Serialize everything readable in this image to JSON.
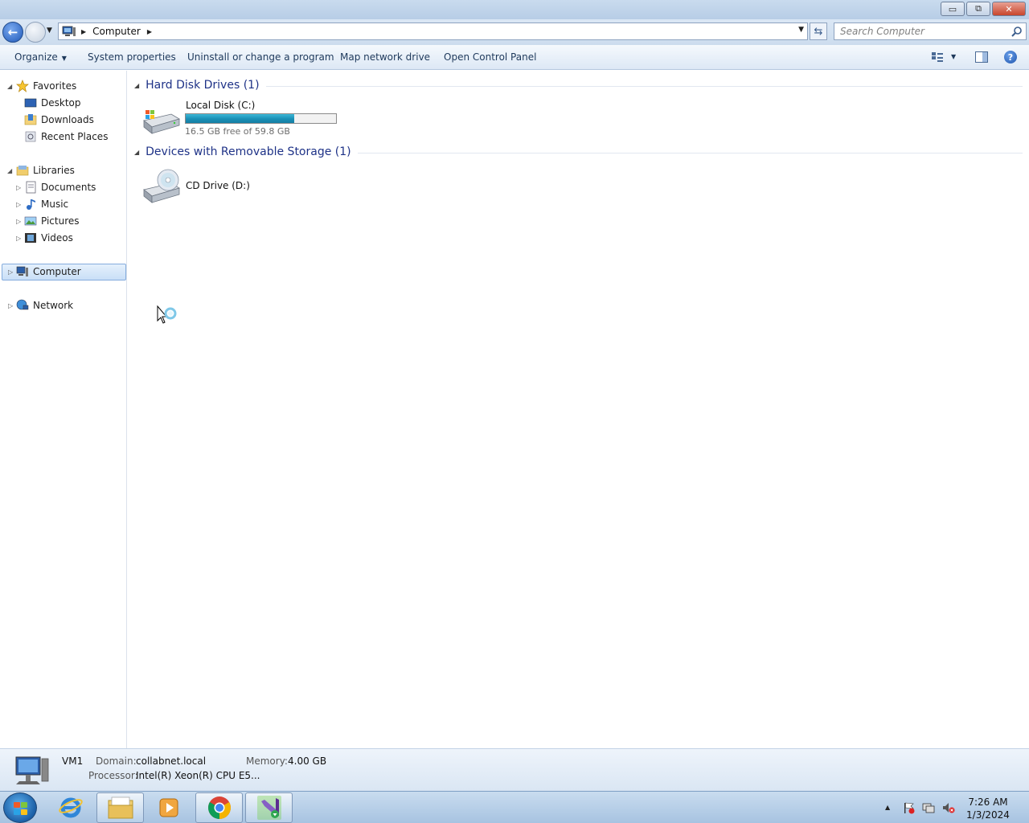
{
  "window": {
    "controls": {
      "minimize": "▭",
      "restore": "⧉",
      "close": "✕"
    }
  },
  "address": {
    "path": "Computer",
    "search_placeholder": "Search Computer"
  },
  "command_bar": {
    "organize": "Organize",
    "system_properties": "System properties",
    "uninstall": "Uninstall or change a program",
    "map_drive": "Map network drive",
    "control_panel": "Open Control Panel"
  },
  "nav": {
    "favorites": {
      "label": "Favorites",
      "items": [
        "Desktop",
        "Downloads",
        "Recent Places"
      ]
    },
    "libraries": {
      "label": "Libraries",
      "items": [
        "Documents",
        "Music",
        "Pictures",
        "Videos"
      ]
    },
    "computer": "Computer",
    "network": "Network"
  },
  "groups": {
    "hard_disks": {
      "title": "Hard Disk Drives (1)",
      "drive": {
        "name": "Local Disk (C:)",
        "free_text": "16.5 GB free of 59.8 GB",
        "used_fraction": 0.72
      }
    },
    "removable": {
      "title": "Devices with Removable Storage (1)",
      "drive": {
        "name": "CD Drive (D:)"
      }
    }
  },
  "details": {
    "name": "VM1",
    "domain_label": "Domain:",
    "domain": "collabnet.local",
    "memory_label": "Memory:",
    "memory": "4.00 GB",
    "processor_label": "Processor:",
    "processor": "Intel(R) Xeon(R) CPU E5..."
  },
  "taskbar": {
    "time": "7:26 AM",
    "date": "1/3/2024",
    "apps": [
      "internet-explorer",
      "windows-explorer",
      "media-player",
      "chrome",
      "visual-studio-installer"
    ]
  },
  "colors": {
    "group_header": "#1e3287",
    "drive_bar": "#1a8fb5",
    "selection": "#c9dff7"
  }
}
